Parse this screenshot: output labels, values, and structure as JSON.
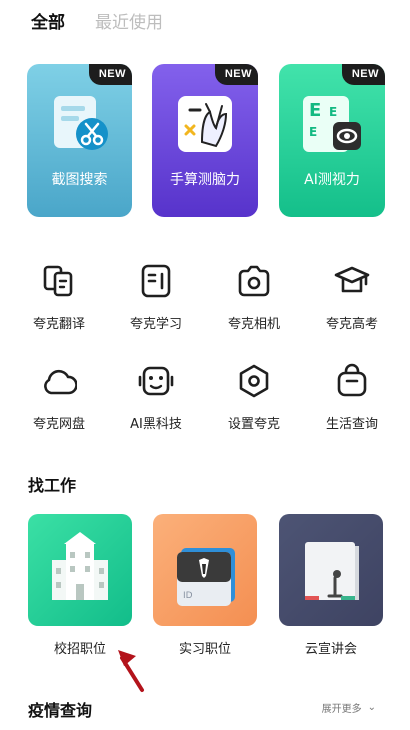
{
  "tabs": {
    "all": "全部",
    "recent": "最近使用"
  },
  "featured": [
    {
      "label": "截图搜索",
      "badge": "NEW",
      "color_top": "#74c8e0",
      "color_bottom": "#4aa9cc"
    },
    {
      "label": "手算测脑力",
      "badge": "NEW",
      "color_top": "#7b57e6",
      "color_bottom": "#5a36cc"
    },
    {
      "label": "AI测视力",
      "badge": "NEW",
      "color_top": "#3ee0a6",
      "color_bottom": "#12c08b"
    }
  ],
  "tools": [
    {
      "label": "夸克翻译",
      "icon": "translate-icon"
    },
    {
      "label": "夸克学习",
      "icon": "study-icon"
    },
    {
      "label": "夸克相机",
      "icon": "camera-icon"
    },
    {
      "label": "夸克高考",
      "icon": "graduation-cap-icon"
    },
    {
      "label": "夸克网盘",
      "icon": "cloud-icon"
    },
    {
      "label": "AI黑科技",
      "icon": "robot-icon"
    },
    {
      "label": "设置夸克",
      "icon": "settings-icon"
    },
    {
      "label": "生活查询",
      "icon": "bag-icon"
    }
  ],
  "jobs_section": {
    "title": "找工作",
    "items": [
      {
        "label": "校招职位",
        "icon": "campus-building-icon",
        "color": "#28cf95"
      },
      {
        "label": "实习职位",
        "icon": "id-card-icon",
        "color": "#f79b60"
      },
      {
        "label": "云宣讲会",
        "icon": "board-icon",
        "color": "#4a4f6e"
      }
    ]
  },
  "epidemic_section": {
    "title": "疫情查询",
    "expand_label": "展开更多"
  },
  "accent": {
    "arrow_color": "#b3131b"
  }
}
